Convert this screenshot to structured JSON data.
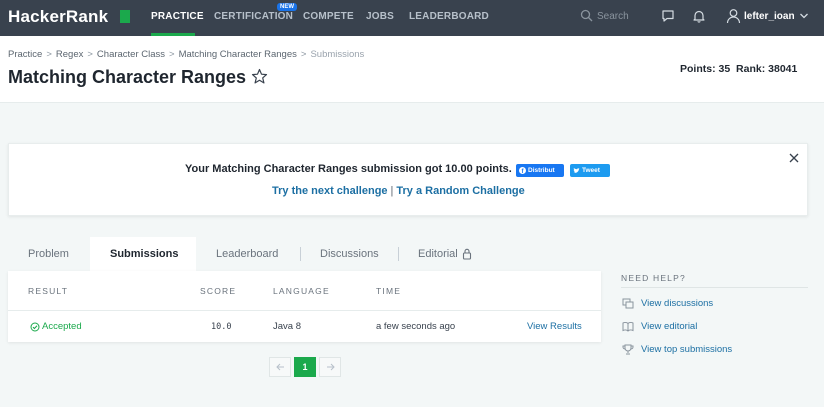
{
  "nav": {
    "logo": "HackerRank",
    "items": [
      {
        "label": "PRACTICE",
        "active": true
      },
      {
        "label": "CERTIFICATION",
        "badge": "NEW"
      },
      {
        "label": "COMPETE"
      },
      {
        "label": "JOBS"
      },
      {
        "label": "LEADERBOARD"
      }
    ],
    "search_placeholder": "Search",
    "username": "lefter_ioan"
  },
  "breadcrumb": [
    "Practice",
    "Regex",
    "Character Class",
    "Matching Character Ranges",
    "Submissions"
  ],
  "page": {
    "title": "Matching Character Ranges",
    "points_label": "Points:",
    "points": "35",
    "rank_label": "Rank:",
    "rank": "38041"
  },
  "banner": {
    "message": "Your Matching Character Ranges submission got 10.00 points.",
    "share_facebook": "Distribut",
    "share_twitter": "Tweet",
    "next_challenge": "Try the next challenge",
    "divider": "|",
    "random_challenge": "Try a Random Challenge"
  },
  "tabs": [
    {
      "label": "Problem"
    },
    {
      "label": "Submissions",
      "active": true
    },
    {
      "label": "Leaderboard"
    },
    {
      "label": "Discussions"
    },
    {
      "label": "Editorial",
      "locked": true
    }
  ],
  "submissions": {
    "headers": [
      "RESULT",
      "SCORE",
      "LANGUAGE",
      "TIME"
    ],
    "rows": [
      {
        "result": "Accepted",
        "score": "10.0",
        "language": "Java 8",
        "time": "a few seconds ago",
        "action": "View Results"
      }
    ]
  },
  "pagination": {
    "current": "1"
  },
  "help": {
    "title": "NEED HELP?",
    "links": [
      "View discussions",
      "View editorial",
      "View top submissions"
    ]
  },
  "colors": {
    "nav_bg": "#39424e",
    "accent_green": "#1ba94c",
    "link_blue": "#1c6fa3",
    "page_bg": "#f3f7f7"
  }
}
